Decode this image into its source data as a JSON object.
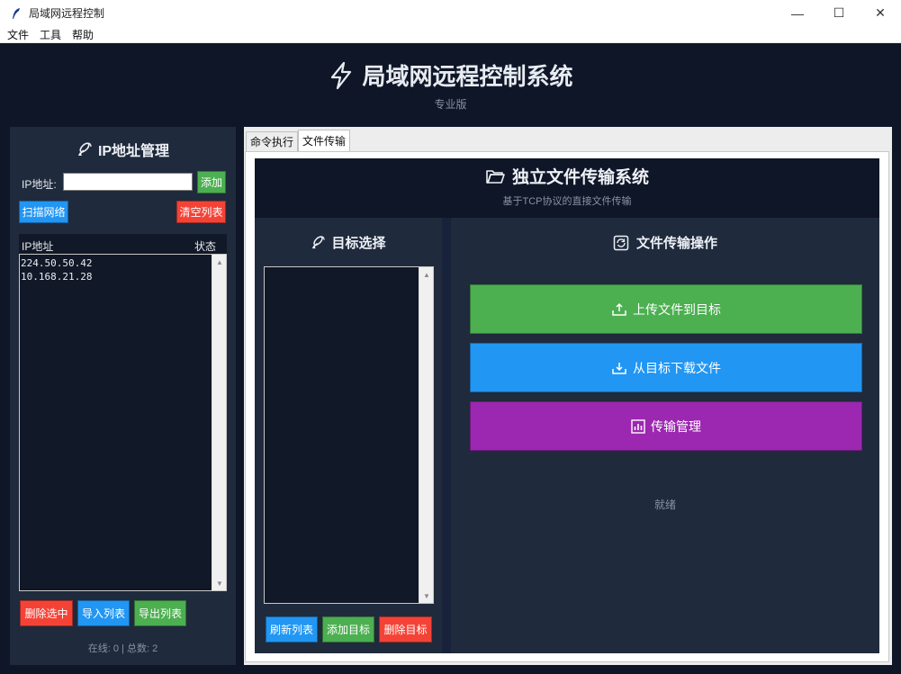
{
  "window": {
    "title": "局域网远程控制",
    "controls": [
      "—",
      "☐",
      "✕"
    ]
  },
  "menubar": {
    "items": [
      "文件",
      "工具",
      "帮助"
    ]
  },
  "header": {
    "title": "局域网远程控制系统",
    "subtitle": "专业版"
  },
  "ip_panel": {
    "title": "IP地址管理",
    "ip_label": "IP地址:",
    "ip_input_value": "",
    "add_button": "添加",
    "scan_button": "扫描网络",
    "clear_button": "清空列表",
    "columns": [
      "IP地址",
      "状态"
    ],
    "rows": [
      "224.50.50.42",
      "10.168.21.28"
    ],
    "delete_selected_button": "删除选中",
    "import_button": "导入列表",
    "export_button": "导出列表",
    "status": "在线: 0 | 总数: 2"
  },
  "tabs": [
    {
      "label": "命令执行",
      "active": false
    },
    {
      "label": "文件传输",
      "active": true
    }
  ],
  "file_transfer": {
    "title": "独立文件传输系统",
    "subtitle": "基于TCP协议的直接文件传输",
    "target_title": "目标选择",
    "refresh_button": "刷新列表",
    "add_target_button": "添加目标",
    "delete_target_button": "删除目标",
    "ops_title": "文件传输操作",
    "upload_button": "上传文件到目标",
    "download_button": "从目标下载文件",
    "manage_button": "传输管理",
    "status": "就绪"
  },
  "colors": {
    "bg_dark": "#0f1627",
    "panel": "#1f2a3c",
    "list_bg": "#111827",
    "green": "#4caf50",
    "blue": "#2196f3",
    "red": "#f44336",
    "purple": "#9c27b0"
  }
}
